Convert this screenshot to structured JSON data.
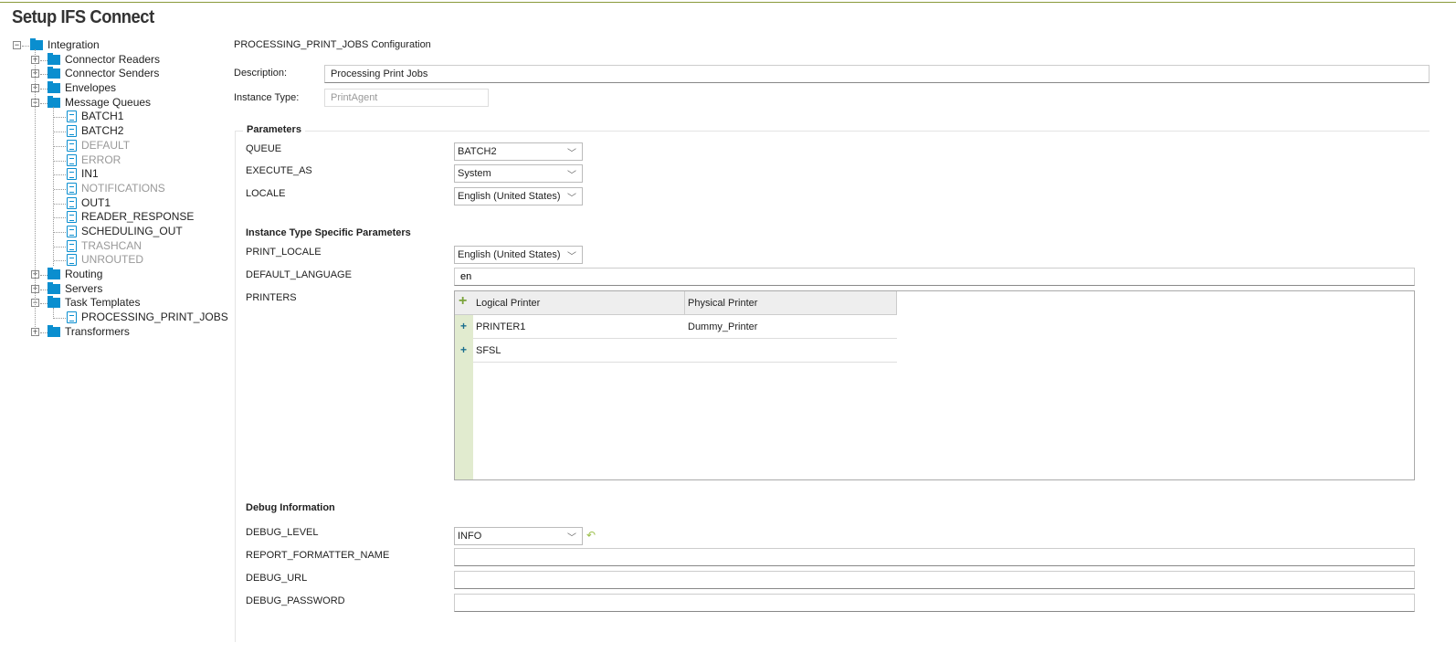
{
  "title": "Setup IFS Connect",
  "tree": {
    "root": "Integration",
    "folders": [
      "Connector Readers",
      "Connector Senders",
      "Envelopes",
      "Message Queues"
    ],
    "queues": [
      {
        "label": "BATCH1",
        "disabled": false
      },
      {
        "label": "BATCH2",
        "disabled": false
      },
      {
        "label": "DEFAULT",
        "disabled": true
      },
      {
        "label": "ERROR",
        "disabled": true
      },
      {
        "label": "IN1",
        "disabled": false
      },
      {
        "label": "NOTIFICATIONS",
        "disabled": true
      },
      {
        "label": "OUT1",
        "disabled": false
      },
      {
        "label": "READER_RESPONSE",
        "disabled": false
      },
      {
        "label": "SCHEDULING_OUT",
        "disabled": false
      },
      {
        "label": "TRASHCAN",
        "disabled": true
      },
      {
        "label": "UNROUTED",
        "disabled": true
      }
    ],
    "folders2": [
      "Routing",
      "Servers",
      "Task Templates"
    ],
    "templates": [
      "PROCESSING_PRINT_JOBS"
    ],
    "folders3": [
      "Transformers"
    ]
  },
  "config": {
    "heading": "PROCESSING_PRINT_JOBS Configuration",
    "description_label": "Description:",
    "description": "Processing Print Jobs",
    "instance_type_label": "Instance Type:",
    "instance_type": "PrintAgent",
    "parameters_title": "Parameters",
    "queue_label": "QUEUE",
    "queue": "BATCH2",
    "execute_as_label": "EXECUTE_AS",
    "execute_as": "System",
    "locale_label": "LOCALE",
    "locale": "English (United States)",
    "specific_title": "Instance Type Specific Parameters",
    "print_locale_label": "PRINT_LOCALE",
    "print_locale": "English (United States)",
    "default_language_label": "DEFAULT_LANGUAGE",
    "default_language": "en",
    "printers_label": "PRINTERS",
    "printers": {
      "columns": [
        "Logical Printer",
        "Physical Printer"
      ],
      "rows": [
        [
          "PRINTER1",
          "Dummy_Printer"
        ],
        [
          "SFSL",
          ""
        ]
      ]
    },
    "debug_title": "Debug Information",
    "debug_level_label": "DEBUG_LEVEL",
    "debug_level": "INFO",
    "report_formatter_label": "REPORT_FORMATTER_NAME",
    "report_formatter": "",
    "debug_url_label": "DEBUG_URL",
    "debug_url": "",
    "debug_password_label": "DEBUG_PASSWORD",
    "debug_password": ""
  }
}
